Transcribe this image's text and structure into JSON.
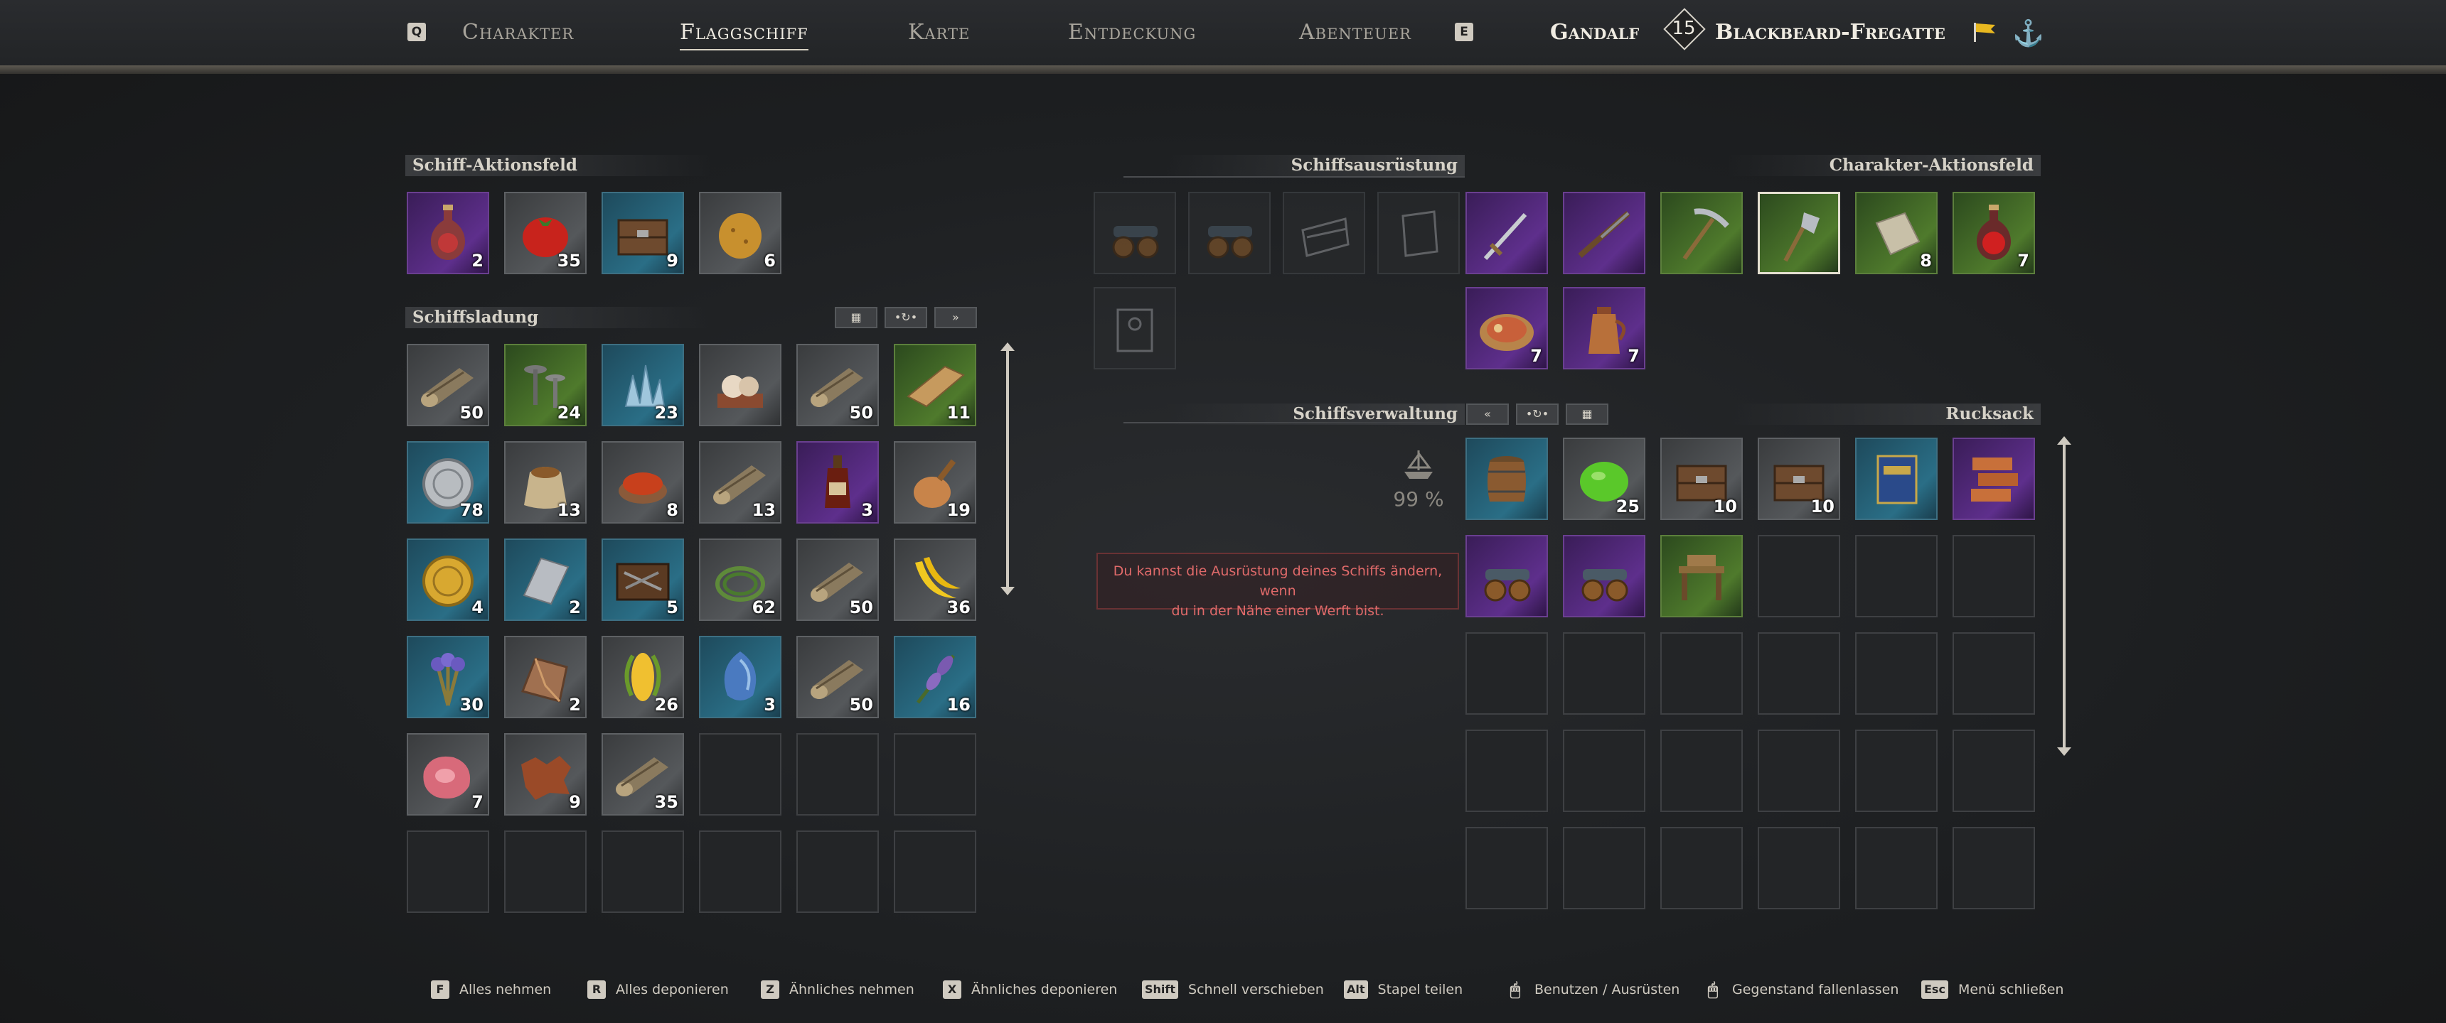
{
  "nav": {
    "left_key": "Q",
    "right_key": "E",
    "tabs": [
      "Charakter",
      "Flaggschiff",
      "Karte",
      "Entdeckung",
      "Abenteuer"
    ],
    "active": "Flaggschiff",
    "player_name": "Gandalf",
    "player_level": "15",
    "ship_name": "Blackbeard-Fregatte"
  },
  "sections": {
    "ship_action_bar": "Schiff-Aktionsfeld",
    "ship_cargo": "Schiffsladung",
    "ship_equipment": "Schiffsausrüstung",
    "char_action_bar": "Charakter-Aktionsfeld",
    "ship_management": "Schiffsverwaltung",
    "backpack": "Rucksack"
  },
  "ship_stat": {
    "percent": "99 %"
  },
  "tooltip": {
    "line1": "Du kannst die Ausrüstung deines Schiffs ändern, wenn",
    "line2": "du in der Nähe einer Werft bist."
  },
  "ship_action_items": [
    {
      "icon": "potion-icon",
      "qty": "2"
    },
    {
      "icon": "tomato-icon",
      "qty": "35"
    },
    {
      "icon": "crate-icon",
      "qty": "9"
    },
    {
      "icon": "potato-icon",
      "qty": "6"
    }
  ],
  "cargo_items": [
    {
      "icon": "wood-log-icon",
      "qty": "50"
    },
    {
      "icon": "nails-icon",
      "qty": "24"
    },
    {
      "icon": "crystal-icon",
      "qty": "23"
    },
    {
      "icon": "pearl-icon",
      "qty": ""
    },
    {
      "icon": "wood-log-icon",
      "qty": "50"
    },
    {
      "icon": "plank-icon",
      "qty": "11"
    },
    {
      "icon": "silver-coin-icon",
      "qty": "78"
    },
    {
      "icon": "grain-sack-icon",
      "qty": "13"
    },
    {
      "icon": "spice-bowl-icon",
      "qty": "8"
    },
    {
      "icon": "wood-log-icon",
      "qty": "13"
    },
    {
      "icon": "rum-bottle-icon",
      "qty": "3"
    },
    {
      "icon": "gourd-icon",
      "qty": "19"
    },
    {
      "icon": "gold-coin-icon",
      "qty": "4"
    },
    {
      "icon": "iron-ingot-icon",
      "qty": "2"
    },
    {
      "icon": "tool-crate-icon",
      "qty": "5"
    },
    {
      "icon": "fiber-icon",
      "qty": "62"
    },
    {
      "icon": "wood-log-icon",
      "qty": "50"
    },
    {
      "icon": "banana-icon",
      "qty": "36"
    },
    {
      "icon": "herb-bundle-icon",
      "qty": "30"
    },
    {
      "icon": "ore-icon",
      "qty": "2"
    },
    {
      "icon": "corn-icon",
      "qty": "26"
    },
    {
      "icon": "blue-gem-icon",
      "qty": "3"
    },
    {
      "icon": "wood-log-icon",
      "qty": "50"
    },
    {
      "icon": "lavender-icon",
      "qty": "16"
    },
    {
      "icon": "raw-meat-icon",
      "qty": "7"
    },
    {
      "icon": "leather-icon",
      "qty": "9"
    },
    {
      "icon": "wood-log-icon",
      "qty": "35"
    }
  ],
  "ship_equipment_items": [
    {
      "icon": "cannon-icon"
    },
    {
      "icon": "cannon-icon"
    },
    {
      "icon": "hull-icon"
    },
    {
      "icon": "sail-icon"
    },
    {
      "icon": "ship-crew-icon"
    }
  ],
  "char_action_items": [
    {
      "icon": "sword-icon",
      "qty": ""
    },
    {
      "icon": "musket-icon",
      "qty": ""
    },
    {
      "icon": "pickaxe-icon",
      "qty": ""
    },
    {
      "icon": "axe-icon",
      "qty": ""
    },
    {
      "icon": "bandage-icon",
      "qty": "8"
    },
    {
      "icon": "health-potion-icon",
      "qty": "7"
    },
    {
      "icon": "food-plate-icon",
      "qty": "7"
    },
    {
      "icon": "coffee-pot-icon",
      "qty": "7"
    }
  ],
  "backpack_items": [
    {
      "icon": "barrel-icon",
      "qty": ""
    },
    {
      "icon": "lime-icon",
      "qty": "25"
    },
    {
      "icon": "crate-icon",
      "qty": "10"
    },
    {
      "icon": "crate-icon",
      "qty": "10"
    },
    {
      "icon": "book-icon",
      "qty": ""
    },
    {
      "icon": "brick-icon",
      "qty": ""
    },
    {
      "icon": "cannon-icon",
      "qty": ""
    },
    {
      "icon": "cannon-icon",
      "qty": ""
    },
    {
      "icon": "workbench-icon",
      "qty": ""
    }
  ],
  "footer": [
    {
      "key": "F",
      "label": "Alles nehmen"
    },
    {
      "key": "R",
      "label": "Alles deponieren"
    },
    {
      "key": "Z",
      "label": "Ähnliches nehmen"
    },
    {
      "key": "X",
      "label": "Ähnliches deponieren"
    },
    {
      "key": "Shift",
      "label": "Schnell verschieben"
    },
    {
      "key": "Alt",
      "label": "Stapel teilen"
    },
    {
      "key": "mouse-icon",
      "label": "Benutzen / Ausrüsten"
    },
    {
      "key": "mouse-icon",
      "label": "Gegenstand fallenlassen"
    },
    {
      "key": "Esc",
      "label": "Menü schließen"
    }
  ],
  "colors": {
    "accent": "#d6d2c8",
    "tooltip_text": "#e06a6a",
    "rare_blue": "#2a6e86",
    "epic_purple": "#5e2f8c",
    "uncommon_green": "#4f7a2c"
  }
}
